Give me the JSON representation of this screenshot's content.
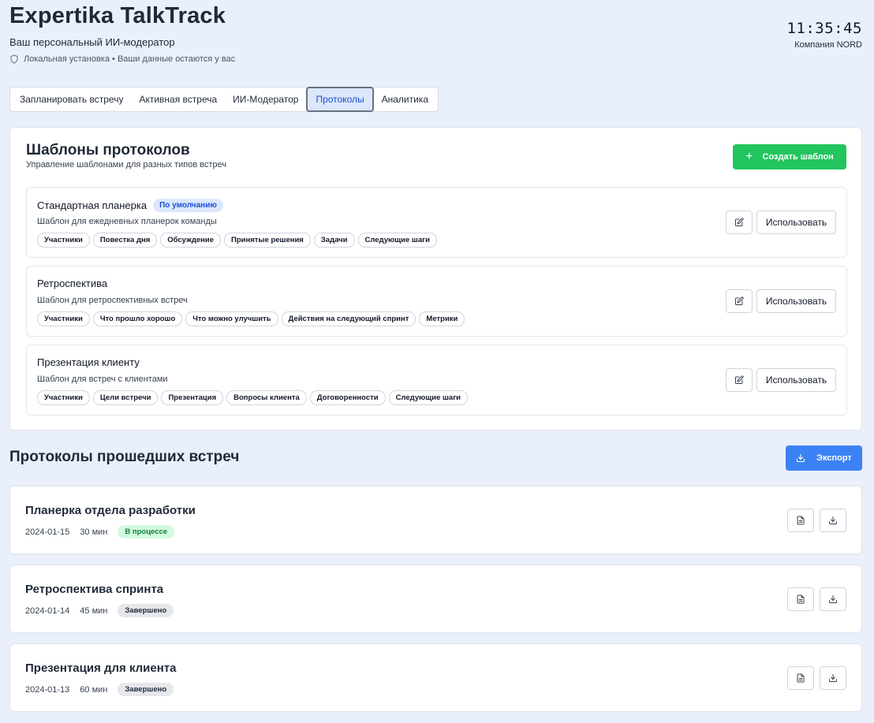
{
  "header": {
    "title": "Expertika TalkTrack",
    "subtitle": "Ваш персональный ИИ-модератор",
    "local_note": "Локальная установка • Ваши данные остаются у вас",
    "clock": "11:35:45",
    "company": "Компания NORD"
  },
  "tabs": [
    {
      "label": "Запланировать встречу",
      "active": false
    },
    {
      "label": "Активная встреча",
      "active": false
    },
    {
      "label": "ИИ-Модератор",
      "active": false
    },
    {
      "label": "Протоколы",
      "active": true
    },
    {
      "label": "Аналитика",
      "active": false
    }
  ],
  "templates_panel": {
    "title": "Шаблоны протоколов",
    "subtitle": "Управление шаблонами для разных типов встреч",
    "create_label": "Создать шаблон",
    "templates": [
      {
        "name": "Стандартная планерка",
        "badge": "По умолчанию",
        "desc": "Шаблон для ежедневных планерок команды",
        "sections": [
          "Участники",
          "Повестка дня",
          "Обсуждение",
          "Принятые решения",
          "Задачи",
          "Следующие шаги"
        ],
        "use_label": "Использовать"
      },
      {
        "name": "Ретроспектива",
        "desc": "Шаблон для ретроспективных встреч",
        "sections": [
          "Участники",
          "Что прошло хорошо",
          "Что можно улучшить",
          "Действия на следующий спринт",
          "Метрики"
        ],
        "use_label": "Использовать"
      },
      {
        "name": "Презентация клиенту",
        "desc": "Шаблон для встреч с клиентами",
        "sections": [
          "Участники",
          "Цели встречи",
          "Презентация",
          "Вопросы клиента",
          "Договоренности",
          "Следующие шаги"
        ],
        "use_label": "Использовать"
      }
    ]
  },
  "records_section": {
    "title": "Протоколы прошедших встреч",
    "export_label": "Экспорт",
    "records": [
      {
        "title": "Планерка отдела разработки",
        "date": "2024-01-15",
        "duration": "30 мин",
        "status": "В процессе",
        "status_kind": "progress"
      },
      {
        "title": "Ретроспектива спринта",
        "date": "2024-01-14",
        "duration": "45 мин",
        "status": "Завершено",
        "status_kind": "done"
      },
      {
        "title": "Презентация для клиента",
        "date": "2024-01-13",
        "duration": "60 мин",
        "status": "Завершено",
        "status_kind": "done"
      }
    ]
  },
  "colors": {
    "background": "#eaeffc",
    "create_button": "#22c55e",
    "export_button": "#3b82f6",
    "active_tab": "#dbe7fb",
    "status_progress": "#d1fadf",
    "status_done": "#e5e7eb"
  }
}
